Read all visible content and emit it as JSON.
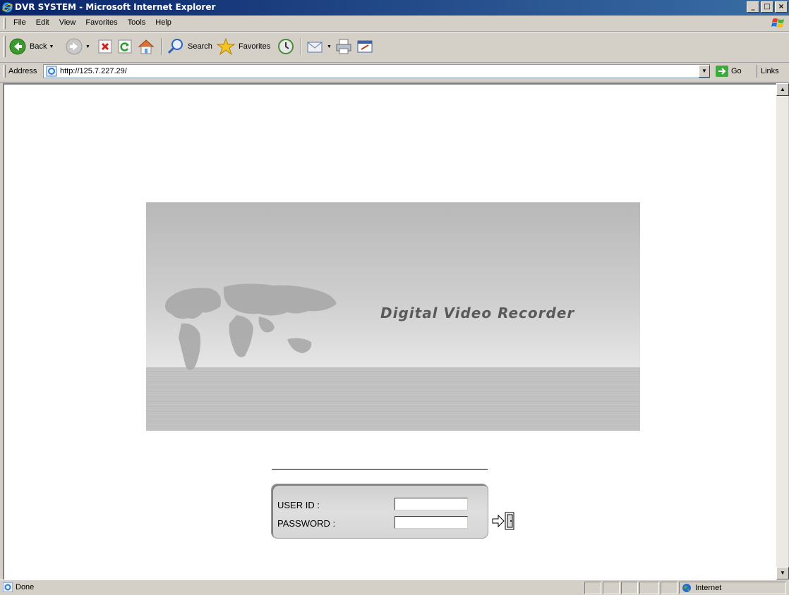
{
  "window": {
    "title": "DVR SYSTEM - Microsoft Internet Explorer",
    "controls": {
      "minimize": "_",
      "maximize": "□",
      "close": "×"
    }
  },
  "menu": [
    "File",
    "Edit",
    "View",
    "Favorites",
    "Tools",
    "Help"
  ],
  "toolbar": {
    "back_label": "Back",
    "search_label": "Search",
    "favorites_label": "Favorites"
  },
  "address": {
    "label": "Address",
    "url": "http://125.7.227.29/",
    "go_label": "Go",
    "links_label": "Links"
  },
  "page": {
    "banner_text": "Digital Video Recorder",
    "login": {
      "user_id_label": "USER ID :",
      "password_label": "PASSWORD :",
      "user_id_value": "",
      "password_value": ""
    }
  },
  "status": {
    "text": "Done",
    "zone": "Internet"
  },
  "colors": {
    "titlebar_start": "#0a246a",
    "titlebar_end": "#3a6ea5",
    "chrome": "#d4d0c8",
    "banner_text": "#5a5a5a"
  },
  "icons": {
    "ie": "ie-logo-icon",
    "back": "back-arrow-icon",
    "forward": "forward-arrow-icon",
    "stop": "stop-icon",
    "refresh": "refresh-icon",
    "home": "home-icon",
    "search": "search-icon",
    "favorites": "favorites-star-icon",
    "history": "history-icon",
    "mail": "mail-icon",
    "print": "print-icon",
    "edit": "edit-icon",
    "go": "go-arrow-icon",
    "enter": "enter-door-icon",
    "globe": "internet-globe-icon"
  }
}
